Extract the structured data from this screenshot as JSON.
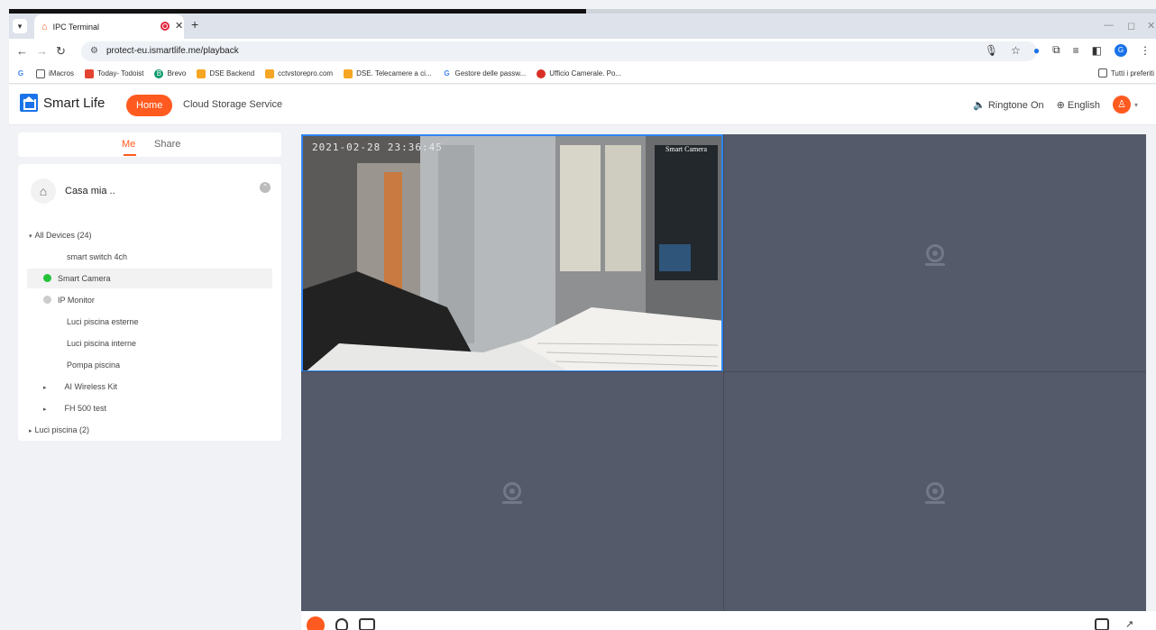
{
  "browser": {
    "tab_title": "IPC Terminal",
    "url": "protect-eu.ismartlife.me/playback",
    "bookmarks": [
      {
        "label": "iMacros",
        "icon": "folder-icon",
        "color": "#555555"
      },
      {
        "label": "Today- Todoist",
        "icon": "todoist-icon",
        "color": "#e44332"
      },
      {
        "label": "Brevo",
        "icon": "brevo-icon",
        "color": "#0b996e"
      },
      {
        "label": "DSE Backend",
        "icon": "dse-icon",
        "color": "#f5a623"
      },
      {
        "label": "cctvstorepro.com",
        "icon": "dse-icon",
        "color": "#f5a623"
      },
      {
        "label": "DSE. Telecamere a ci...",
        "icon": "dse-icon",
        "color": "#f5a623"
      },
      {
        "label": "Gestore delle passw...",
        "icon": "google-icon",
        "color": "#4285f4"
      },
      {
        "label": "Ufficio Camerale. Po...",
        "icon": "ufficio-icon",
        "color": "#d93025"
      }
    ],
    "bookmarks_folder_right": "Tutti i preferiti"
  },
  "app": {
    "brand": "Smart Life",
    "home_label": "Home",
    "cloud_label": "Cloud Storage Service",
    "ringtone_label": "Ringtone On",
    "language_label": "English",
    "accent_color": "#ff5a1f"
  },
  "sidebar": {
    "tabs": [
      "Me",
      "Share"
    ],
    "home_name": "Casa mia ..",
    "tree": [
      {
        "label": "All Devices (24)",
        "indent": 0,
        "arrow": "▾",
        "status": null
      },
      {
        "label": "smart switch 4ch",
        "indent": 2,
        "arrow": null,
        "status": null
      },
      {
        "label": "Smart Camera",
        "indent": 1,
        "arrow": null,
        "status": "online",
        "selected": true
      },
      {
        "label": "IP Monitor",
        "indent": 1,
        "arrow": null,
        "status": "offline"
      },
      {
        "label": "Luci piscina esterne",
        "indent": 2,
        "arrow": null,
        "status": null
      },
      {
        "label": "Luci piscina interne",
        "indent": 2,
        "arrow": null,
        "status": null
      },
      {
        "label": "Pompa piscina",
        "indent": 2,
        "arrow": null,
        "status": null
      },
      {
        "label": "AI Wireless Kit",
        "indent": 1,
        "arrow": "▸",
        "status": null
      },
      {
        "label": "FH 500 test",
        "indent": 1,
        "arrow": "▸",
        "status": null
      },
      {
        "label": "Luci piscina (2)",
        "indent": 0,
        "arrow": "▸",
        "status": null
      }
    ]
  },
  "video": {
    "timestamp": "2021-02-28 23:36:45",
    "camera_name": "Smart Camera"
  }
}
